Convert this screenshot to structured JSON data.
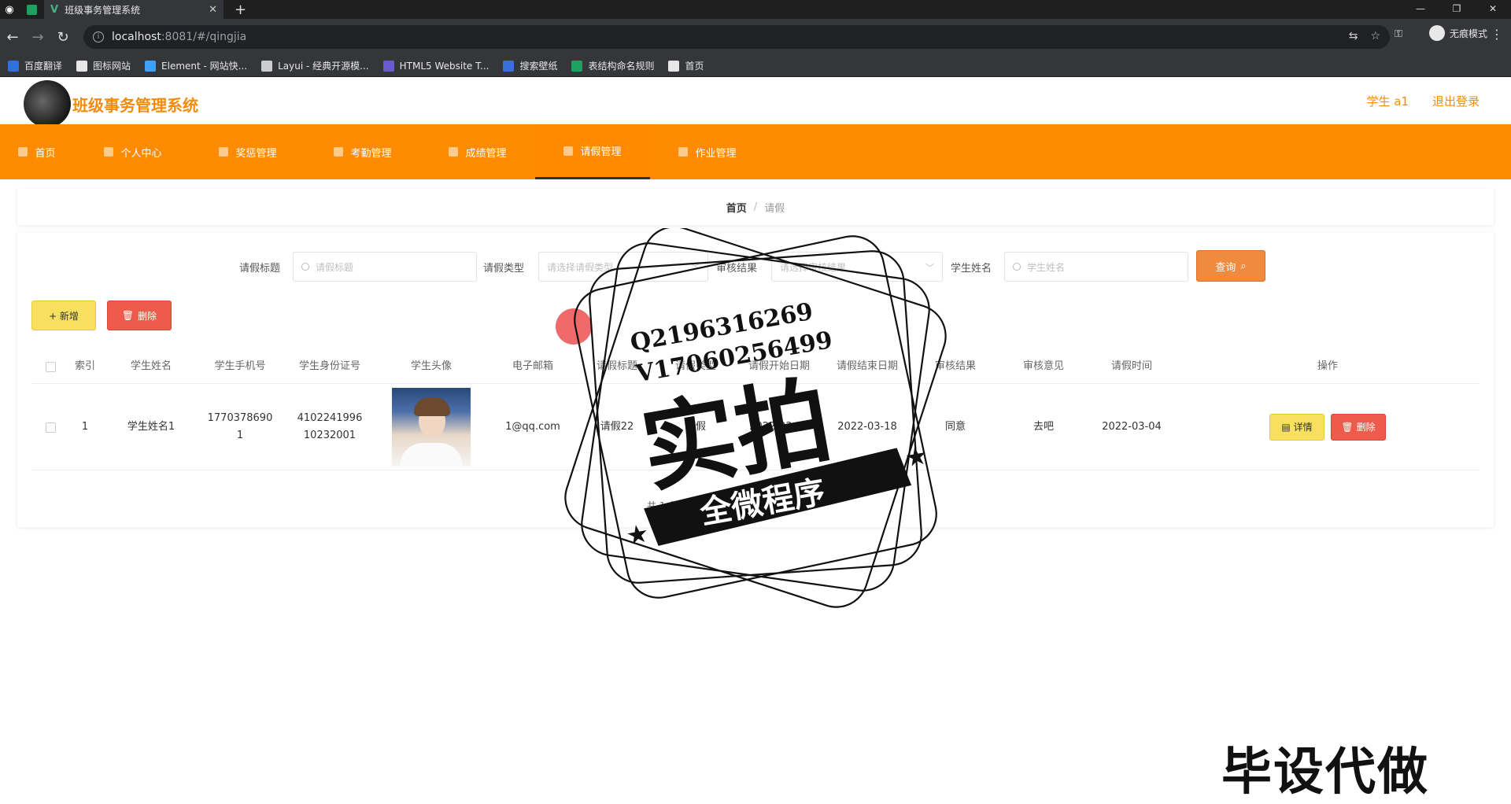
{
  "browser": {
    "tab_title": "班级事务管理系统",
    "url_host": "localhost",
    "url_path": ":8081/#/qingjia",
    "incognito_label": "无痕模式",
    "bookmarks": [
      {
        "label": "百度翻译",
        "color": "#2f6fde"
      },
      {
        "label": "图标网站",
        "color": "#e8e8e8"
      },
      {
        "label": "Element - 网站快...",
        "color": "#409eff"
      },
      {
        "label": "Layui - 经典开源模...",
        "color": "#cccccc"
      },
      {
        "label": "HTML5 Website T...",
        "color": "#6a5acd"
      },
      {
        "label": "搜索壁纸",
        "color": "#3a6fd8"
      },
      {
        "label": "表结构命名规则",
        "color": "#1aa260"
      },
      {
        "label": "首页",
        "color": "#e8e8e8"
      }
    ]
  },
  "header": {
    "site_name": "班级事务管理系统",
    "user": "学生 a1",
    "logout": "退出登录",
    "accent": "#ff8c00"
  },
  "nav": {
    "items": [
      {
        "label": "首页"
      },
      {
        "label": "个人中心"
      },
      {
        "label": "奖惩管理"
      },
      {
        "label": "考勤管理"
      },
      {
        "label": "成绩管理"
      },
      {
        "label": "请假管理"
      },
      {
        "label": "作业管理"
      }
    ],
    "active_index": 5
  },
  "breadcrumb": {
    "home": "首页",
    "separator": "/",
    "current": "请假"
  },
  "search": {
    "title_label": "请假标题",
    "title_placeholder": "请假标题",
    "type_label": "请假类型",
    "type_placeholder": "请选择请假类型",
    "result_label": "审核结果",
    "result_placeholder": "请选择审核结果",
    "name_label": "学生姓名",
    "name_placeholder": "学生姓名",
    "query_button": "查询"
  },
  "actions": {
    "add": "+ 新增",
    "delete": "删除"
  },
  "table": {
    "columns": [
      "索引",
      "学生姓名",
      "学生手机号",
      "学生身份证号",
      "学生头像",
      "电子邮箱",
      "请假标题",
      "请假类型",
      "请假开始日期",
      "请假结束日期",
      "审核结果",
      "审核意见",
      "请假时间",
      "操作"
    ],
    "rows": [
      {
        "index": "1",
        "name": "学生姓名1",
        "phone_line1": "1770378690",
        "phone_line2": "1",
        "id_line1": "4102241996",
        "id_line2": "10232001",
        "email": "1@qq.com",
        "title": "请假22",
        "type": "病假",
        "start": "2022-03-16",
        "end": "2022-03-18",
        "result": "同意",
        "opinion": "去吧",
        "time": "2022-03-04",
        "detail_btn": "详情",
        "delete_btn": "删除"
      }
    ],
    "total": "共 1 条"
  },
  "watermark": {
    "line1": "Q2196316269",
    "line2": "V17060256499",
    "big": "实拍",
    "ribbon": "全微程序",
    "bottom": "毕设代做"
  }
}
